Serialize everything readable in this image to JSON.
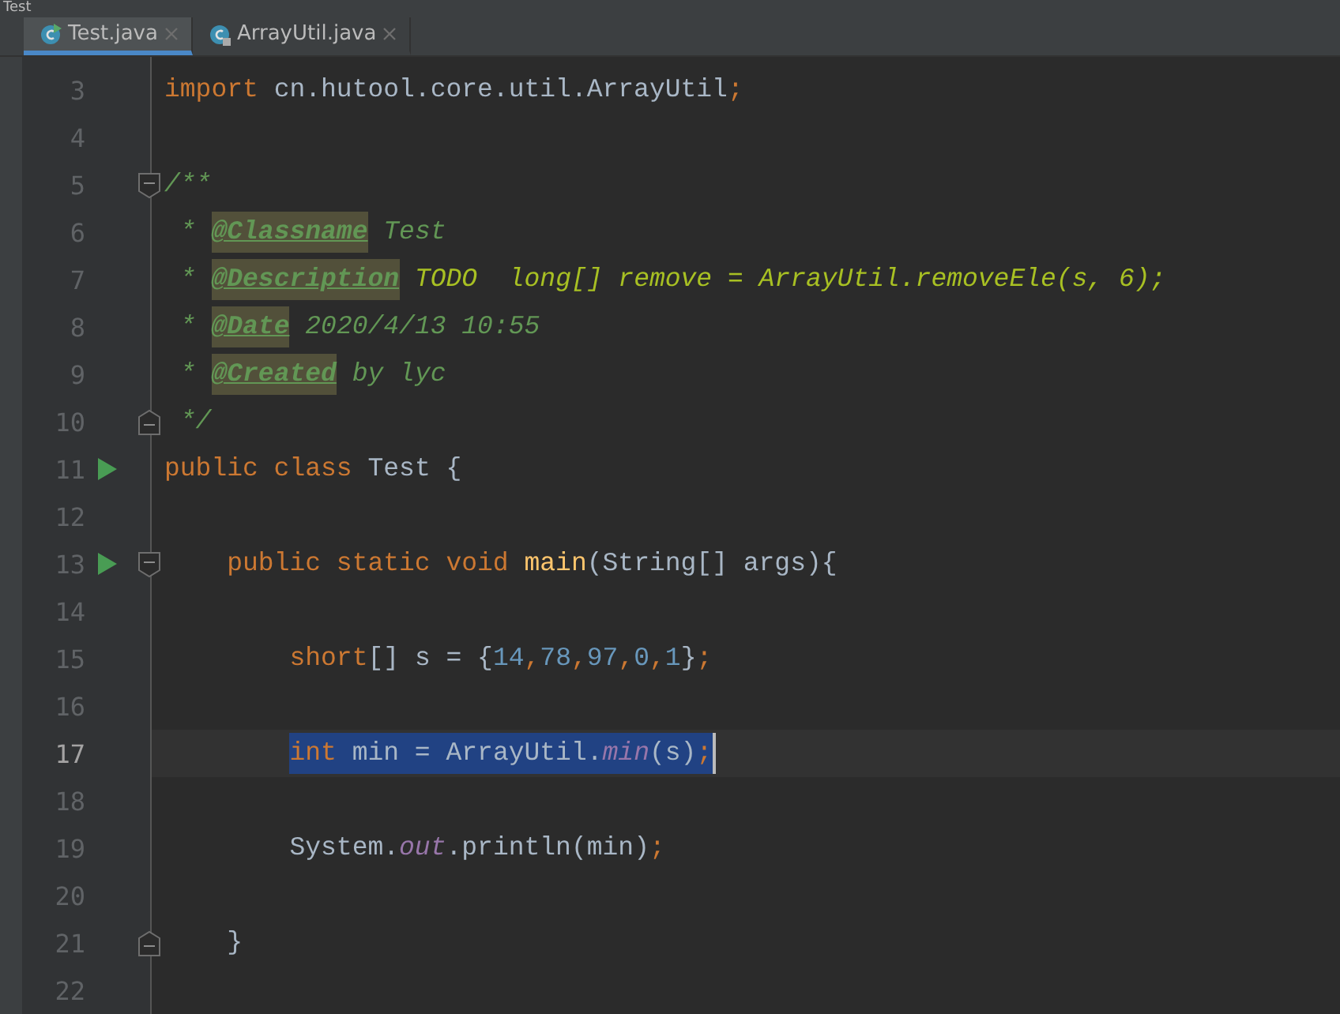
{
  "window": {
    "title": "Test"
  },
  "tabs": [
    {
      "label": "Test.java",
      "selected": true,
      "kind": "runnable"
    },
    {
      "label": "ArrayUtil.java",
      "selected": false,
      "kind": "locked"
    }
  ],
  "lines": [
    {
      "number": "3",
      "tokens": [
        {
          "kind": "keyword",
          "text": "import "
        },
        {
          "kind": "plain",
          "text": "cn.hutool.core.util.ArrayUtil"
        },
        {
          "kind": "punct",
          "text": ";"
        }
      ]
    },
    {
      "number": "4"
    },
    {
      "number": "5",
      "fold_start": true,
      "tokens": [
        {
          "kind": "doc",
          "text": "/**"
        }
      ]
    },
    {
      "number": "6",
      "tokens": [
        {
          "kind": "doc",
          "text": " * "
        },
        {
          "kind": "doctag",
          "text": "@Classname"
        },
        {
          "kind": "doc",
          "text": " Test"
        }
      ]
    },
    {
      "number": "7",
      "tokens": [
        {
          "kind": "doc",
          "text": " * "
        },
        {
          "kind": "doctag",
          "text": "@Description"
        },
        {
          "kind": "todo",
          "text": " TODO  long[] remove = ArrayUtil.removeEle(s, 6);"
        }
      ]
    },
    {
      "number": "8",
      "tokens": [
        {
          "kind": "doc",
          "text": " * "
        },
        {
          "kind": "doctag",
          "text": "@Date"
        },
        {
          "kind": "doc",
          "text": " 2020/4/13 10:55"
        }
      ]
    },
    {
      "number": "9",
      "tokens": [
        {
          "kind": "doc",
          "text": " * "
        },
        {
          "kind": "doctag",
          "text": "@Created"
        },
        {
          "kind": "doc",
          "text": " by lyc"
        }
      ]
    },
    {
      "number": "10",
      "fold_end": true,
      "tokens": [
        {
          "kind": "doc",
          "text": " */"
        }
      ]
    },
    {
      "number": "11",
      "run": true,
      "tokens": [
        {
          "kind": "keyword",
          "text": "public class "
        },
        {
          "kind": "plain",
          "text": "Test {"
        }
      ]
    },
    {
      "number": "12"
    },
    {
      "number": "13",
      "run": true,
      "fold_start": true,
      "tokens": [
        {
          "kind": "keyword",
          "text": "    public static void "
        },
        {
          "kind": "method",
          "text": "main"
        },
        {
          "kind": "plain",
          "text": "(String[] args){"
        }
      ]
    },
    {
      "number": "14"
    },
    {
      "number": "15",
      "tokens": [
        {
          "kind": "keyword",
          "text": "        short"
        },
        {
          "kind": "plain",
          "text": "[] s = {"
        },
        {
          "kind": "number",
          "text": "14"
        },
        {
          "kind": "punct",
          "text": ","
        },
        {
          "kind": "number",
          "text": "78"
        },
        {
          "kind": "punct",
          "text": ","
        },
        {
          "kind": "number",
          "text": "97"
        },
        {
          "kind": "punct",
          "text": ","
        },
        {
          "kind": "number",
          "text": "0"
        },
        {
          "kind": "punct",
          "text": ","
        },
        {
          "kind": "number",
          "text": "1"
        },
        {
          "kind": "plain",
          "text": "}"
        },
        {
          "kind": "punct",
          "text": ";"
        }
      ]
    },
    {
      "number": "16"
    },
    {
      "number": "17",
      "current": true,
      "tokens": [
        {
          "kind": "keyword",
          "text": "        int ",
          "selected": true
        },
        {
          "kind": "plain",
          "text": "min = ArrayUtil.",
          "selected": true
        },
        {
          "kind": "static",
          "text": "min",
          "selected": true
        },
        {
          "kind": "plain",
          "text": "(s)",
          "selected": true
        },
        {
          "kind": "punct",
          "text": ";",
          "selected": true
        }
      ]
    },
    {
      "number": "18"
    },
    {
      "number": "19",
      "tokens": [
        {
          "kind": "plain",
          "text": "        System."
        },
        {
          "kind": "static",
          "text": "out"
        },
        {
          "kind": "plain",
          "text": ".println(min)"
        },
        {
          "kind": "punct",
          "text": ";"
        }
      ]
    },
    {
      "number": "20"
    },
    {
      "number": "21",
      "fold_end": true,
      "tokens": [
        {
          "kind": "plain",
          "text": "    }"
        }
      ]
    },
    {
      "number": "22"
    }
  ]
}
